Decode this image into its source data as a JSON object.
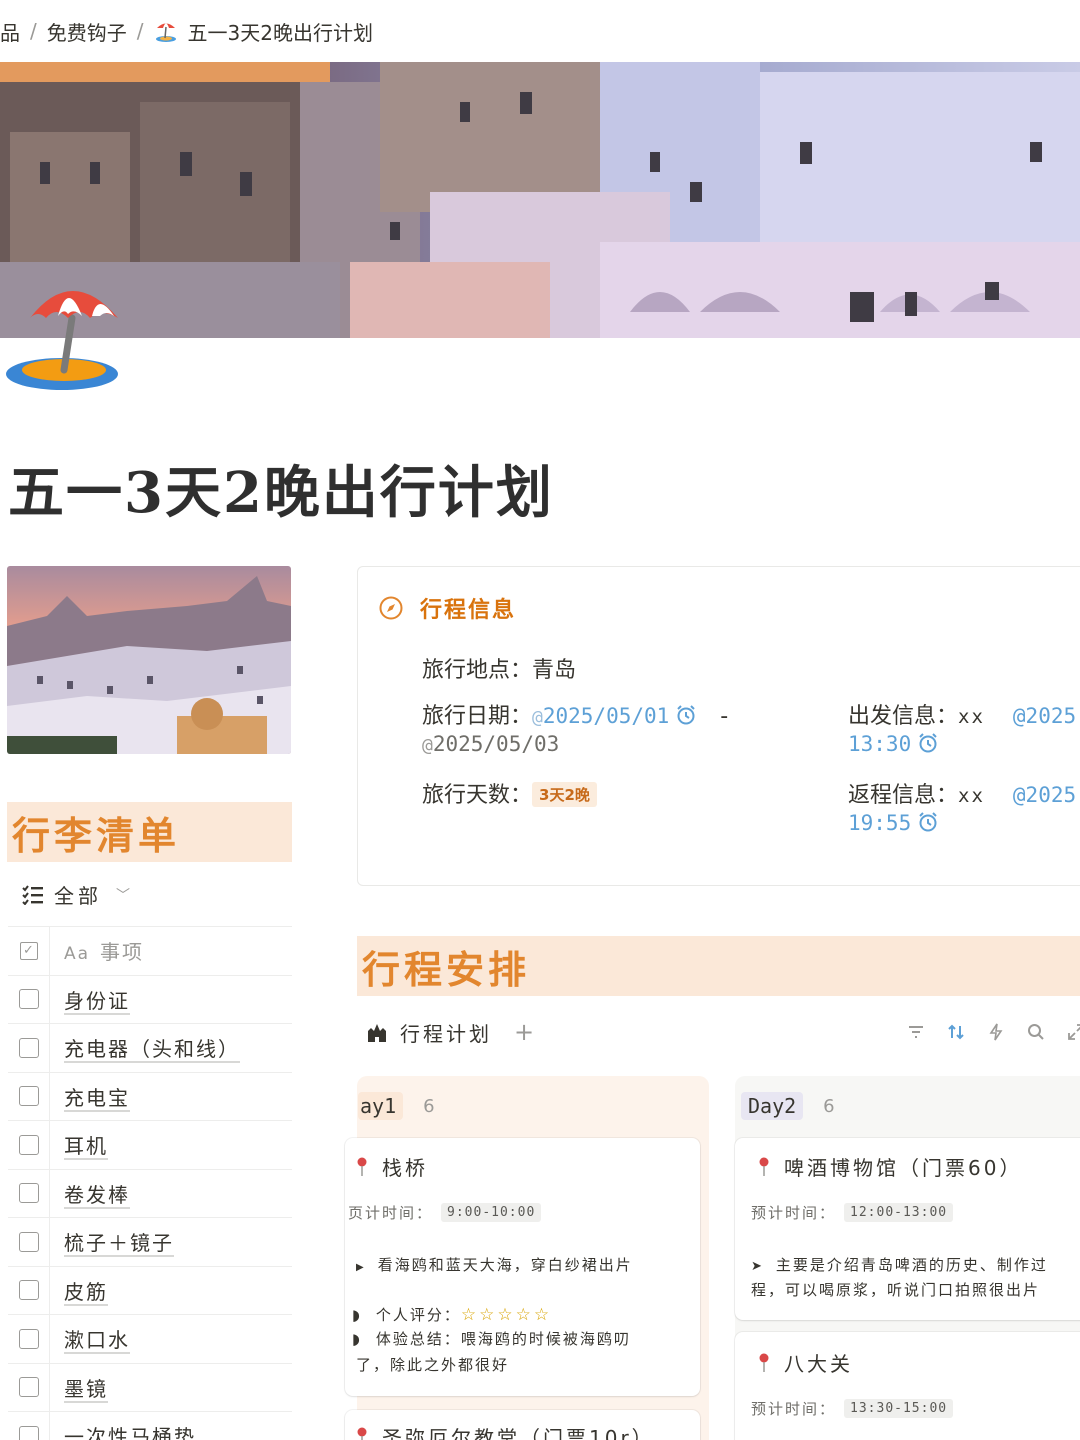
{
  "breadcrumb": {
    "items": [
      "品",
      "免费钩子",
      "五一3天2晚出行计划"
    ],
    "separator": "/"
  },
  "page": {
    "title": "五一3天2晚出行计划",
    "icon": "beach-umbrella-icon"
  },
  "luggage": {
    "heading": "行李清单",
    "view_label": "全部",
    "column_header_icon": "Aa",
    "column_header": "事项",
    "items": [
      "身份证",
      "充电器（头和线）",
      "充电宝",
      "耳机",
      "卷发棒",
      "梳子＋镜子",
      "皮筋",
      "漱口水",
      "墨镜",
      "一次性马桶垫"
    ]
  },
  "trip_info": {
    "heading": "行程信息",
    "location_label": "旅行地点：",
    "location_value": "青岛",
    "date_label": "旅行日期：",
    "date_start": "2025/05/01",
    "date_dash": "-",
    "date_end": "2025/05/03",
    "days_label": "旅行天数：",
    "days_value": "3天2晚",
    "depart_label": "出发信息：",
    "depart_value": "xx",
    "depart_date": "@2025",
    "depart_time": "13:30",
    "return_label": "返程信息：",
    "return_value": "xx",
    "return_date": "@2025",
    "return_time": "19:55"
  },
  "itinerary": {
    "heading": "行程安排",
    "view_label": "行程计划",
    "add_label": "+",
    "groups": [
      {
        "name": "ay1",
        "count": "6",
        "cards": [
          {
            "title": "栈桥",
            "time_label": "预计时间：",
            "time_label_visible": "页计时间：",
            "time": "9:00-10:00",
            "note": "看海鸥和蓝天大海，穿白纱裙出片",
            "rating_label": "个人评分：",
            "rating": 5,
            "summary_line1": "体验总结：喂海鸥的时候被海鸥叨",
            "summary_line2": "了，除此之外都很好"
          },
          {
            "title": "圣弥厄尔教堂（门票10r）"
          }
        ]
      },
      {
        "name": "Day2",
        "count": "6",
        "cards": [
          {
            "title": "啤酒博物馆（门票60）",
            "time_label": "预计时间：",
            "time": "12:00-13:00",
            "note_line1": "主要是介绍青岛啤酒的历史、制作过",
            "note_line2": "程，可以喝原浆，听说门口拍照很出片"
          },
          {
            "title": "八大关",
            "time_label": "预计时间：",
            "time": "13:30-15:00"
          }
        ]
      }
    ]
  },
  "colors": {
    "accent_orange": "#e2862e",
    "heading_bg": "#fbe8d8",
    "mention_blue": "#5da0d6",
    "star_gold": "#d9a400"
  }
}
